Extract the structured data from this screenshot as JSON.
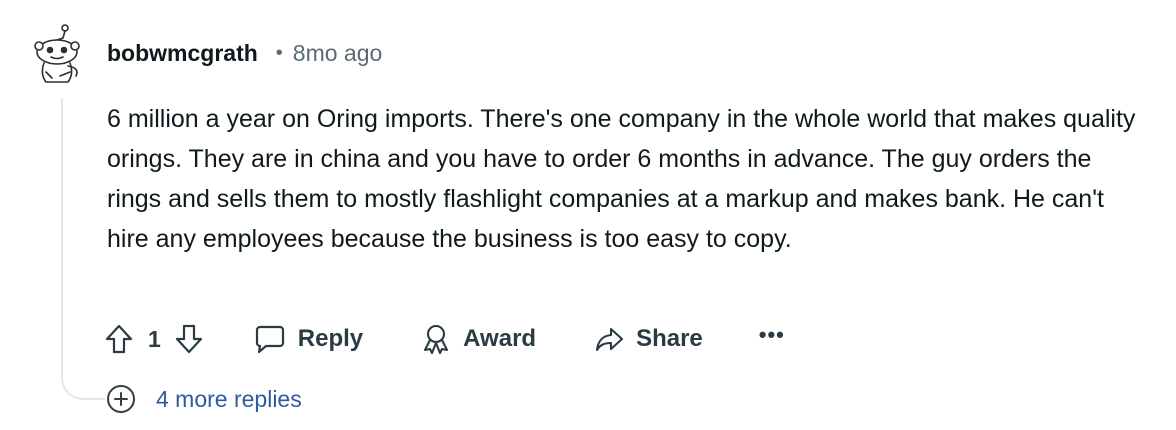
{
  "comment": {
    "username": "bobwmcgrath",
    "separator": "•",
    "time_ago": "8mo ago",
    "body": "6 million a year on Oring imports. There's one company in the whole world that makes quality orings. They are in china and you have to order 6 months in advance. The guy orders the rings and sells them to mostly flashlight companies at a markup and makes bank. He can't hire any employees because the business is too easy to copy."
  },
  "actions": {
    "upvote_icon": "arrow-up-icon",
    "score": "1",
    "downvote_icon": "arrow-down-icon",
    "reply_label": "Reply",
    "reply_icon": "speech-bubble-icon",
    "award_label": "Award",
    "award_icon": "award-ribbon-icon",
    "share_label": "Share",
    "share_icon": "share-arrow-icon",
    "more_label": "•••"
  },
  "more_replies": {
    "label": "4 more replies",
    "icon": "plus-circle-icon"
  },
  "colors": {
    "text": "#0f1a1c",
    "muted": "#5b6b73",
    "link": "#2f5b9e",
    "thread_line": "#e2e7e9"
  }
}
